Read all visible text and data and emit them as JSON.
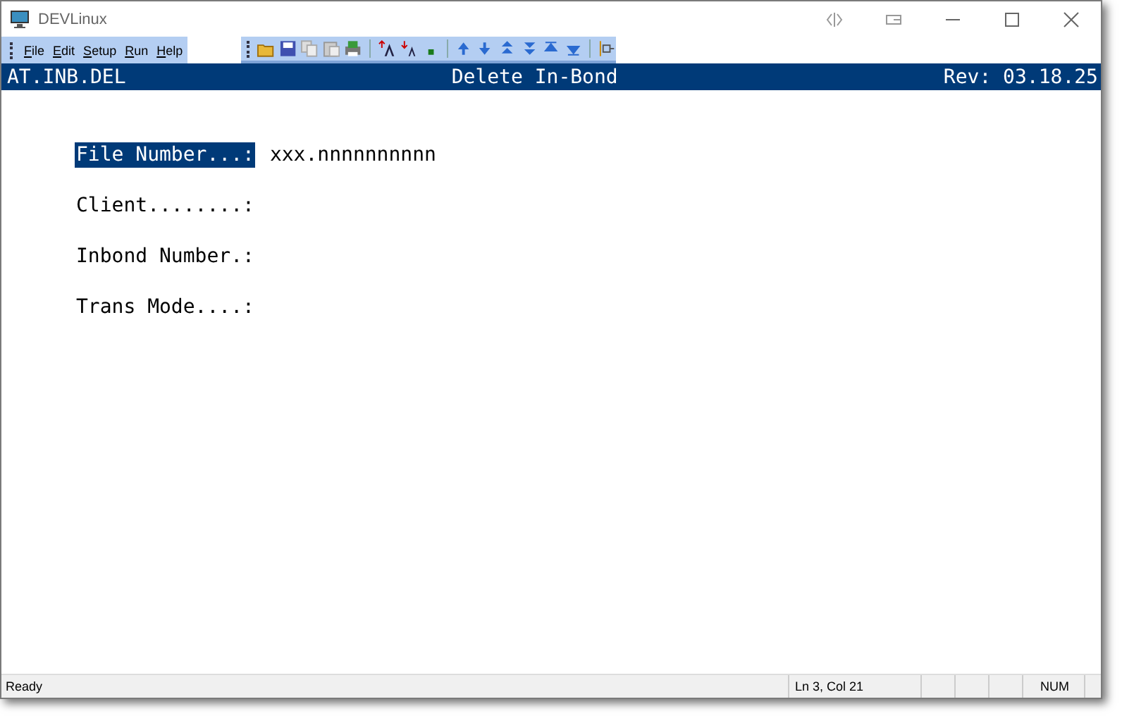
{
  "window": {
    "title": "DEVLinux"
  },
  "menu": [
    {
      "label": "File"
    },
    {
      "label": "Edit"
    },
    {
      "label": "Setup"
    },
    {
      "label": "Run"
    },
    {
      "label": "Help"
    }
  ],
  "header": {
    "program": "AT.INB.DEL",
    "title": "Delete In-Bond",
    "revision": "Rev: 03.18.25"
  },
  "fields": [
    {
      "label": "File Number...:",
      "value": "xxx.nnnnnnnnnn",
      "selected": true
    },
    {
      "label": "Client........:",
      "selected": false
    },
    {
      "label": "Inbond Number.:",
      "selected": false
    },
    {
      "label": "Trans Mode....:",
      "selected": false
    }
  ],
  "status_bar": {
    "message": "Ready",
    "position": "Ln 3, Col 21",
    "num": "NUM"
  }
}
